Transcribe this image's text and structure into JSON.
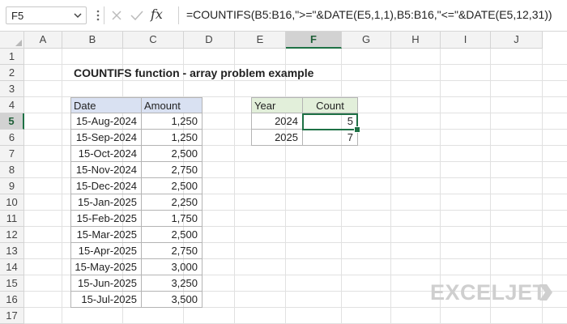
{
  "formula_bar": {
    "name_box": "F5",
    "fx_label": "fx",
    "formula": "=COUNTIFS(B5:B16,\">=\"&DATE(E5,1,1),B5:B16,\"<=\"&DATE(E5,12,31))"
  },
  "columns": [
    "A",
    "B",
    "C",
    "D",
    "E",
    "F",
    "G",
    "H",
    "I",
    "J"
  ],
  "rows": [
    "1",
    "2",
    "3",
    "4",
    "5",
    "6",
    "7",
    "8",
    "9",
    "10",
    "11",
    "12",
    "13",
    "14",
    "15",
    "16",
    "17"
  ],
  "selected_cell": "F5",
  "sheet": {
    "title": "COUNTIFS function - array problem example",
    "data_table": {
      "headers": [
        "Date",
        "Amount"
      ],
      "rows": [
        [
          "15-Aug-2024",
          "1,250"
        ],
        [
          "15-Sep-2024",
          "1,250"
        ],
        [
          "15-Oct-2024",
          "2,500"
        ],
        [
          "15-Nov-2024",
          "2,750"
        ],
        [
          "15-Dec-2024",
          "2,500"
        ],
        [
          "15-Jan-2025",
          "2,250"
        ],
        [
          "15-Feb-2025",
          "1,750"
        ],
        [
          "15-Mar-2025",
          "2,500"
        ],
        [
          "15-Apr-2025",
          "2,750"
        ],
        [
          "15-May-2025",
          "3,000"
        ],
        [
          "15-Jun-2025",
          "3,250"
        ],
        [
          "15-Jul-2025",
          "3,500"
        ]
      ]
    },
    "summary_table": {
      "headers": [
        "Year",
        "Count"
      ],
      "rows": [
        [
          "2024",
          "5"
        ],
        [
          "2025",
          "7"
        ]
      ]
    }
  },
  "watermark": "EXCELJET",
  "colors": {
    "header_blue": "#d9e1f2",
    "header_green": "#e2efda",
    "selection": "#1e7145"
  }
}
